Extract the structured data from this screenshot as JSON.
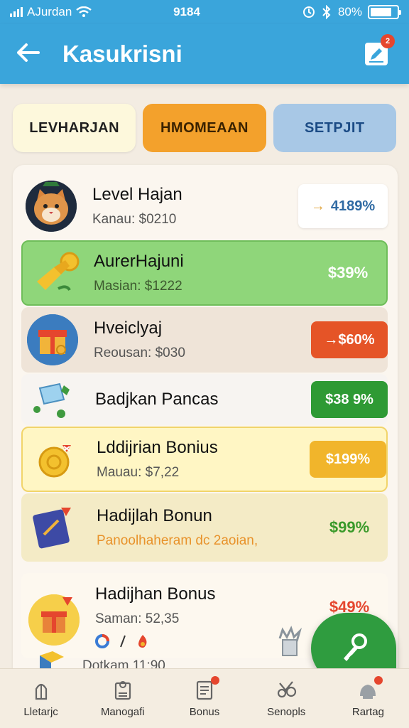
{
  "status_bar": {
    "carrier": "AJurdan",
    "time": "9184",
    "battery": "80%"
  },
  "header": {
    "title": "Kasukrisni",
    "badge": "2"
  },
  "tabs": [
    {
      "label": "LEVHARJAN"
    },
    {
      "label": "HMOMEAAN"
    },
    {
      "label": "SETPJIT"
    }
  ],
  "rows": [
    {
      "title": "Level Hajan",
      "subtitle": "Kanau: $0210",
      "value": "4189%",
      "arrow": "→"
    },
    {
      "title": "AurerHajuni",
      "subtitle": "Masian: $1222",
      "value": "$39%"
    },
    {
      "title": "Hveiclyaj",
      "subtitle": "Reousan: $030",
      "value": "→$60%"
    },
    {
      "title": "Badjkan Pancas",
      "subtitle": "",
      "value": "$38 9%"
    },
    {
      "title": "Lddijrian Bonius",
      "subtitle": "Mauau: $7,22",
      "value": "$199%"
    },
    {
      "title": "Hadijlah Bonun",
      "subtitle": "Panoolhaheram dc 2aoian,",
      "value": "$99%"
    },
    {
      "title": "Hadijhan Bonus",
      "subtitle": "Saman: 52,35",
      "value": "$49%"
    }
  ],
  "cut_row": {
    "text": "Dotkam 11:90"
  },
  "nav": [
    {
      "label": "Lletarjc"
    },
    {
      "label": "Manogafi"
    },
    {
      "label": "Bonus"
    },
    {
      "label": "Senopls"
    },
    {
      "label": "Rartag"
    }
  ],
  "colors": {
    "primary": "#3aa5db",
    "green_row": "#8fd67a",
    "orange_pill": "#e55427",
    "green_pill": "#2e9a34",
    "yellow_pill": "#f1b52b"
  }
}
